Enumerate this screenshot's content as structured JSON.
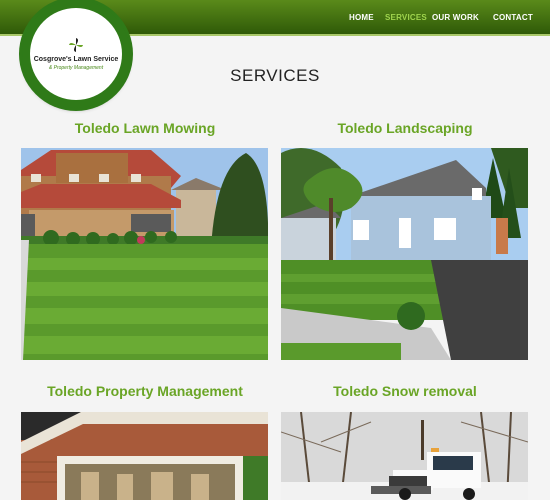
{
  "logo": {
    "name": "Cosgrove's Lawn Service",
    "tagline": "& Property Management"
  },
  "nav": {
    "home": "HOME",
    "services": "SERVICES",
    "our_work": "OUR WORK",
    "contact": "CONTACT",
    "active": "services"
  },
  "page_title": "SERVICES",
  "services": [
    {
      "title": "Toledo Lawn Mowing"
    },
    {
      "title": "Toledo Landscaping"
    },
    {
      "title": "Toledo Property Management"
    },
    {
      "title": "Toledo Snow removal"
    }
  ],
  "colors": {
    "header_dark": "#2f5a08",
    "header_light": "#5a8a1a",
    "accent_green": "#6aa526",
    "nav_active": "#9fd44d"
  }
}
